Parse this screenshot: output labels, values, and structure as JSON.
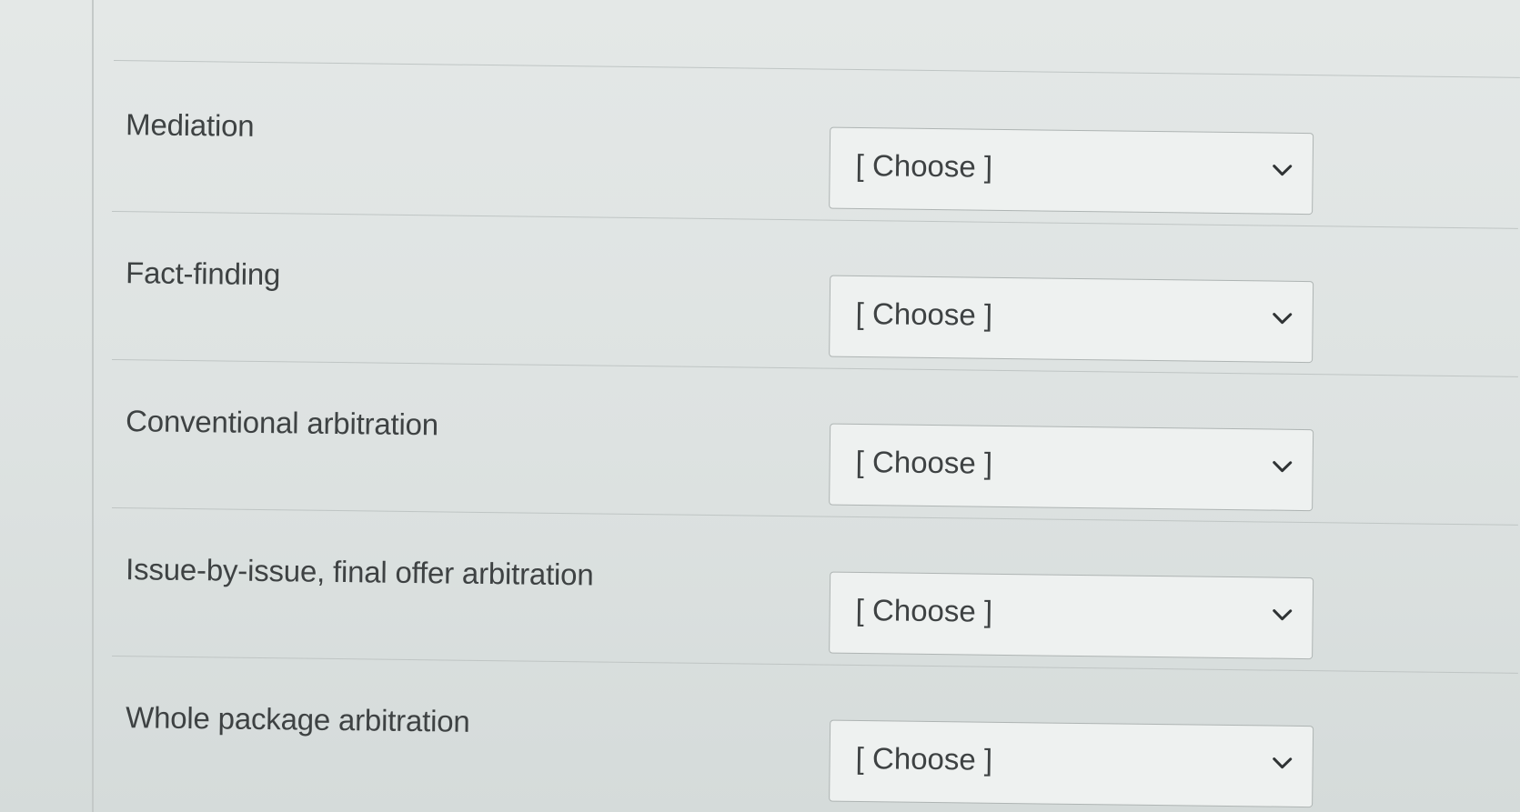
{
  "questions": [
    {
      "label": "Mediation",
      "selected": "[ Choose ]"
    },
    {
      "label": "Fact-finding",
      "selected": "[ Choose ]"
    },
    {
      "label": "Conventional arbitration",
      "selected": "[ Choose ]"
    },
    {
      "label": "Issue-by-issue, final offer arbitration",
      "selected": "[ Choose ]"
    },
    {
      "label": "Whole package arbitration",
      "selected": "[ Choose ]"
    }
  ],
  "icons": {
    "dropdown": "chevron-down-icon"
  },
  "colors": {
    "background": "#dfe3e2",
    "text": "#3e4243",
    "border": "#aeb4b3"
  }
}
